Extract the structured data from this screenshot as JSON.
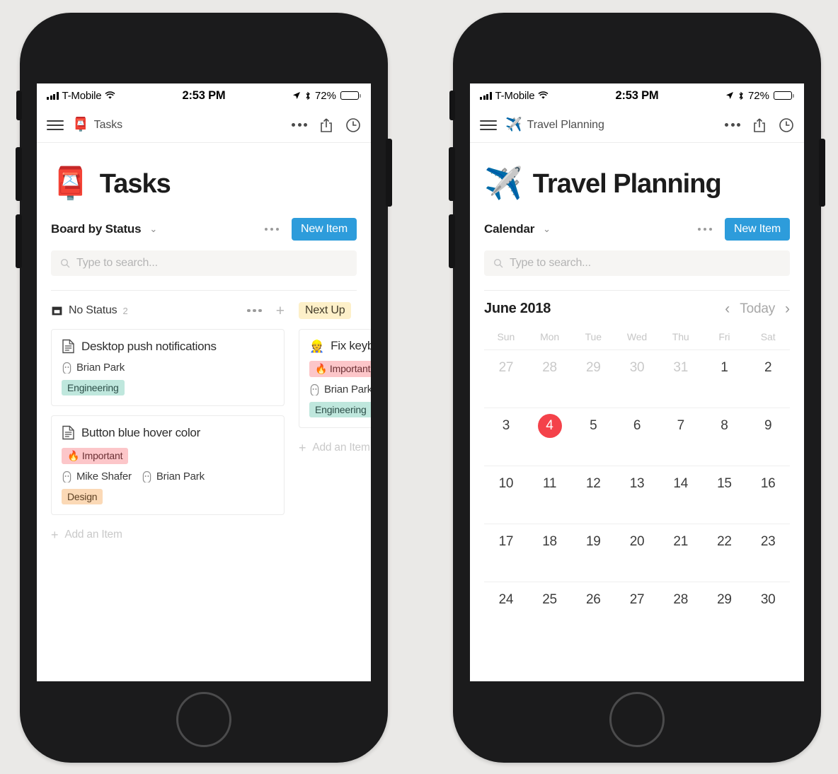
{
  "status_bar": {
    "carrier": "T-Mobile",
    "time": "2:53 PM",
    "battery_pct": "72%",
    "signal_icon": "signal-bars-icon",
    "wifi_icon": "wifi-icon",
    "location_icon": "location-arrow-icon",
    "bluetooth_icon": "bluetooth-icon",
    "battery_icon": "battery-icon"
  },
  "colors": {
    "accent_blue": "#2d9cdb",
    "today_red": "#f4424a",
    "tag_important_bg": "#fcc6c9",
    "tag_engineering_bg": "#bfe7dd",
    "tag_design_bg": "#fbd9b6",
    "pill_nextup_bg": "#fdf0c9",
    "search_bg": "#f6f5f3",
    "page_bg": "#eae9e7"
  },
  "phone_left": {
    "navbar": {
      "menu_icon": "hamburger-menu-icon",
      "emoji": "📮",
      "title": "Tasks",
      "more_icon": "ellipsis-icon",
      "share_icon": "share-icon",
      "history_icon": "clock-icon"
    },
    "page": {
      "emoji": "📮",
      "title": "Tasks",
      "view_name": "Board by Status",
      "view_caret": "⌄",
      "new_item_label": "New Item",
      "search_placeholder": "Type to search...",
      "search_value": ""
    },
    "board": {
      "columns": [
        {
          "name": "No Status",
          "icon": "inbox-tray-icon",
          "count": "2",
          "style": "plain",
          "add_item_label": "Add an Item",
          "cards": [
            {
              "icon": "document-icon",
              "title": "Desktop push notifications",
              "tags_top": [],
              "people": [
                "Brian Park"
              ],
              "tags_bottom": [
                "Engineering"
              ]
            },
            {
              "icon": "document-icon",
              "title": "Button blue hover color",
              "tags_top": [
                "Important"
              ],
              "people": [
                "Mike Shafer",
                "Brian Park"
              ],
              "tags_bottom": [
                "Design"
              ]
            }
          ]
        },
        {
          "name": "Next Up",
          "icon": "",
          "count": "",
          "style": "pill",
          "add_item_label": "Add an Item",
          "cards": [
            {
              "icon": "👷",
              "title": "Fix keyboard shortcuts",
              "tags_top": [
                "Important"
              ],
              "people": [
                "Brian Park"
              ],
              "tags_bottom": [
                "Engineering"
              ]
            }
          ]
        }
      ]
    }
  },
  "phone_right": {
    "navbar": {
      "menu_icon": "hamburger-menu-icon",
      "emoji": "✈️",
      "title": "Travel Planning",
      "more_icon": "ellipsis-icon",
      "share_icon": "share-icon",
      "history_icon": "clock-icon"
    },
    "page": {
      "emoji": "✈️",
      "title": "Travel Planning",
      "view_name": "Calendar",
      "view_caret": "⌄",
      "new_item_label": "New Item",
      "search_placeholder": "Type to search...",
      "search_value": ""
    },
    "calendar": {
      "month_label": "June 2018",
      "prev_label": "‹",
      "today_label": "Today",
      "next_label": "›",
      "weekdays": [
        "Sun",
        "Mon",
        "Tue",
        "Wed",
        "Thu",
        "Fri",
        "Sat"
      ],
      "today_day": 4,
      "weeks": [
        [
          {
            "n": "27",
            "muted": true
          },
          {
            "n": "28",
            "muted": true
          },
          {
            "n": "29",
            "muted": true
          },
          {
            "n": "30",
            "muted": true
          },
          {
            "n": "31",
            "muted": true
          },
          {
            "n": "1",
            "muted": false
          },
          {
            "n": "2",
            "muted": false
          }
        ],
        [
          {
            "n": "3",
            "muted": false
          },
          {
            "n": "4",
            "muted": false,
            "today": true
          },
          {
            "n": "5",
            "muted": false
          },
          {
            "n": "6",
            "muted": false
          },
          {
            "n": "7",
            "muted": false
          },
          {
            "n": "8",
            "muted": false
          },
          {
            "n": "9",
            "muted": false
          }
        ],
        [
          {
            "n": "10",
            "muted": false
          },
          {
            "n": "11",
            "muted": false
          },
          {
            "n": "12",
            "muted": false
          },
          {
            "n": "13",
            "muted": false
          },
          {
            "n": "14",
            "muted": false
          },
          {
            "n": "15",
            "muted": false
          },
          {
            "n": "16",
            "muted": false
          }
        ],
        [
          {
            "n": "17",
            "muted": false
          },
          {
            "n": "18",
            "muted": false
          },
          {
            "n": "19",
            "muted": false
          },
          {
            "n": "20",
            "muted": false
          },
          {
            "n": "21",
            "muted": false
          },
          {
            "n": "22",
            "muted": false
          },
          {
            "n": "23",
            "muted": false
          }
        ],
        [
          {
            "n": "24",
            "muted": false
          },
          {
            "n": "25",
            "muted": false
          },
          {
            "n": "26",
            "muted": false
          },
          {
            "n": "27",
            "muted": false
          },
          {
            "n": "28",
            "muted": false
          },
          {
            "n": "29",
            "muted": false
          },
          {
            "n": "30",
            "muted": false
          }
        ]
      ]
    }
  }
}
